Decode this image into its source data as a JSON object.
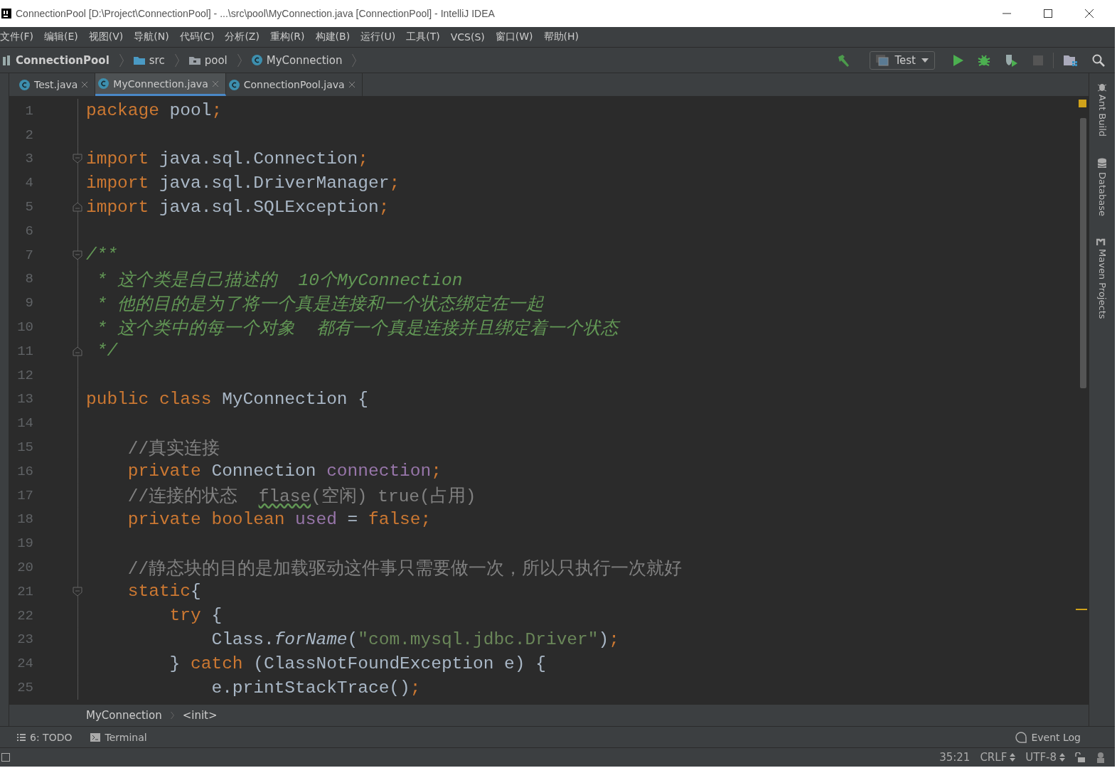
{
  "window": {
    "title": "ConnectionPool [D:\\Project\\ConnectionPool] - ...\\src\\pool\\MyConnection.java [ConnectionPool] - IntelliJ IDEA"
  },
  "menu": [
    "文件(F)",
    "编辑(E)",
    "视图(V)",
    "导航(N)",
    "代码(C)",
    "分析(Z)",
    "重构(R)",
    "构建(B)",
    "运行(U)",
    "工具(T)",
    "VCS(S)",
    "窗口(W)",
    "帮助(H)"
  ],
  "navbar": {
    "crumbs": [
      {
        "label": "ConnectionPool",
        "kind": "project"
      },
      {
        "label": "src",
        "kind": "folder"
      },
      {
        "label": "pool",
        "kind": "package"
      },
      {
        "label": "MyConnection",
        "kind": "class"
      }
    ],
    "run_config": "Test"
  },
  "tabs": [
    {
      "label": "Test.java",
      "selected": false
    },
    {
      "label": "MyConnection.java",
      "selected": true
    },
    {
      "label": "ConnectionPool.java",
      "selected": false
    }
  ],
  "editor": {
    "lines": [
      {
        "number": "1",
        "fold_start": false,
        "fold_end": false,
        "tokens": [
          {
            "kind": "kw",
            "text": "package"
          },
          {
            "kind": "plain",
            "text": " pool"
          },
          {
            "kind": "kw",
            "text": ";"
          }
        ]
      },
      {
        "number": "2",
        "fold_start": false,
        "fold_end": false
      },
      {
        "number": "3",
        "fold_start": true,
        "fold_end": false,
        "tokens": [
          {
            "kind": "kw",
            "text": "import"
          },
          {
            "kind": "plain",
            "text": " java.sql.Connection"
          },
          {
            "kind": "kw",
            "text": ";"
          }
        ]
      },
      {
        "number": "4",
        "fold_start": false,
        "fold_end": false,
        "tokens": [
          {
            "kind": "kw",
            "text": "import"
          },
          {
            "kind": "plain",
            "text": " java.sql.DriverManager"
          },
          {
            "kind": "kw",
            "text": ";"
          }
        ]
      },
      {
        "number": "5",
        "fold_start": false,
        "fold_end": true,
        "tokens": [
          {
            "kind": "kw",
            "text": "import"
          },
          {
            "kind": "plain",
            "text": " java.sql.SQLException"
          },
          {
            "kind": "kw",
            "text": ";"
          }
        ]
      },
      {
        "number": "6",
        "fold_start": false,
        "fold_end": false
      },
      {
        "number": "7",
        "fold_start": true,
        "fold_end": false,
        "tokens": [
          {
            "kind": "doc",
            "text": "/**"
          }
        ]
      },
      {
        "number": "8",
        "fold_start": false,
        "fold_end": false,
        "tokens": [
          {
            "kind": "doc",
            "text": " * 这个类是自己描述的  10个MyConnection"
          }
        ]
      },
      {
        "number": "9",
        "fold_start": false,
        "fold_end": false,
        "tokens": [
          {
            "kind": "doc",
            "text": " * 他的目的是为了将一个真是连接和一个状态绑定在一起"
          }
        ]
      },
      {
        "number": "10",
        "fold_start": false,
        "fold_end": false,
        "tokens": [
          {
            "kind": "doc",
            "text": " * 这个类中的每一个对象  都有一个真是连接并且绑定着一个状态"
          }
        ]
      },
      {
        "number": "11",
        "fold_start": false,
        "fold_end": true,
        "tokens": [
          {
            "kind": "doc",
            "text": " */"
          }
        ]
      },
      {
        "number": "12",
        "fold_start": false,
        "fold_end": false
      },
      {
        "number": "13",
        "fold_start": false,
        "fold_end": false,
        "tokens": [
          {
            "kind": "kw",
            "text": "public class"
          },
          {
            "kind": "plain",
            "text": " MyConnection {"
          }
        ]
      },
      {
        "number": "14",
        "fold_start": false,
        "fold_end": false
      },
      {
        "number": "15",
        "fold_start": false,
        "fold_end": false,
        "tokens": [
          {
            "kind": "comment",
            "text": "    //真实连接"
          }
        ]
      },
      {
        "number": "16",
        "fold_start": false,
        "fold_end": false,
        "tokens": [
          {
            "kind": "kw",
            "text": "    private"
          },
          {
            "kind": "plain",
            "text": " Connection "
          },
          {
            "kind": "field",
            "text": "connection"
          },
          {
            "kind": "kw",
            "text": ";"
          }
        ]
      },
      {
        "number": "17",
        "fold_start": false,
        "fold_end": false,
        "tokens": [
          {
            "kind": "comment",
            "text": "    //连接的状态  "
          },
          {
            "kind": "typo",
            "text": "flase"
          },
          {
            "kind": "comment",
            "text": "(空闲) true(占用)"
          }
        ]
      },
      {
        "number": "18",
        "fold_start": false,
        "fold_end": false,
        "tokens": [
          {
            "kind": "kw",
            "text": "    private boolean"
          },
          {
            "kind": "field",
            "text": " used"
          },
          {
            "kind": "plain",
            "text": " = "
          },
          {
            "kind": "kw",
            "text": "false;"
          }
        ]
      },
      {
        "number": "19",
        "fold_start": false,
        "fold_end": false
      },
      {
        "number": "20",
        "fold_start": false,
        "fold_end": false,
        "tokens": [
          {
            "kind": "comment",
            "text": "    //静态块的目的是加载驱动这件事只需要做一次，所以只执行一次就好"
          }
        ]
      },
      {
        "number": "21",
        "fold_start": true,
        "fold_end": false,
        "tokens": [
          {
            "kind": "kw",
            "text": "    static"
          },
          {
            "kind": "plain",
            "text": "{"
          }
        ]
      },
      {
        "number": "22",
        "fold_start": false,
        "fold_end": false,
        "tokens": [
          {
            "kind": "kw",
            "text": "        try"
          },
          {
            "kind": "plain",
            "text": " {"
          }
        ]
      },
      {
        "number": "23",
        "fold_start": false,
        "fold_end": false,
        "tokens": [
          {
            "kind": "plain",
            "text": "            Class."
          },
          {
            "kind": "method",
            "text": "forName"
          },
          {
            "kind": "plain",
            "text": "("
          },
          {
            "kind": "string",
            "text": "\"com.mysql.jdbc.Driver\""
          },
          {
            "kind": "plain",
            "text": ")"
          },
          {
            "kind": "kw",
            "text": ";"
          }
        ]
      },
      {
        "number": "24",
        "fold_start": false,
        "fold_end": false,
        "tokens": [
          {
            "kind": "plain",
            "text": "        } "
          },
          {
            "kind": "kw",
            "text": "catch"
          },
          {
            "kind": "plain",
            "text": " (ClassNotFoundException e) {"
          }
        ]
      },
      {
        "number": "25",
        "fold_start": false,
        "fold_end": false,
        "tokens": [
          {
            "kind": "plain",
            "text": "            e.printStackTrace()"
          },
          {
            "kind": "kw",
            "text": ";"
          }
        ]
      }
    ]
  },
  "breadcrumb": [
    "MyConnection",
    "<init>"
  ],
  "right_tools": [
    "Ant Build",
    "Database",
    "Maven Projects"
  ],
  "tool_windows": [
    {
      "label": "6: TODO",
      "kind": "list"
    },
    {
      "label": "Terminal",
      "kind": "terminal"
    }
  ],
  "event_log": "Event Log",
  "status_bar": {
    "position": "35:21",
    "line_sep": "CRLF",
    "encoding": "UTF-8"
  }
}
